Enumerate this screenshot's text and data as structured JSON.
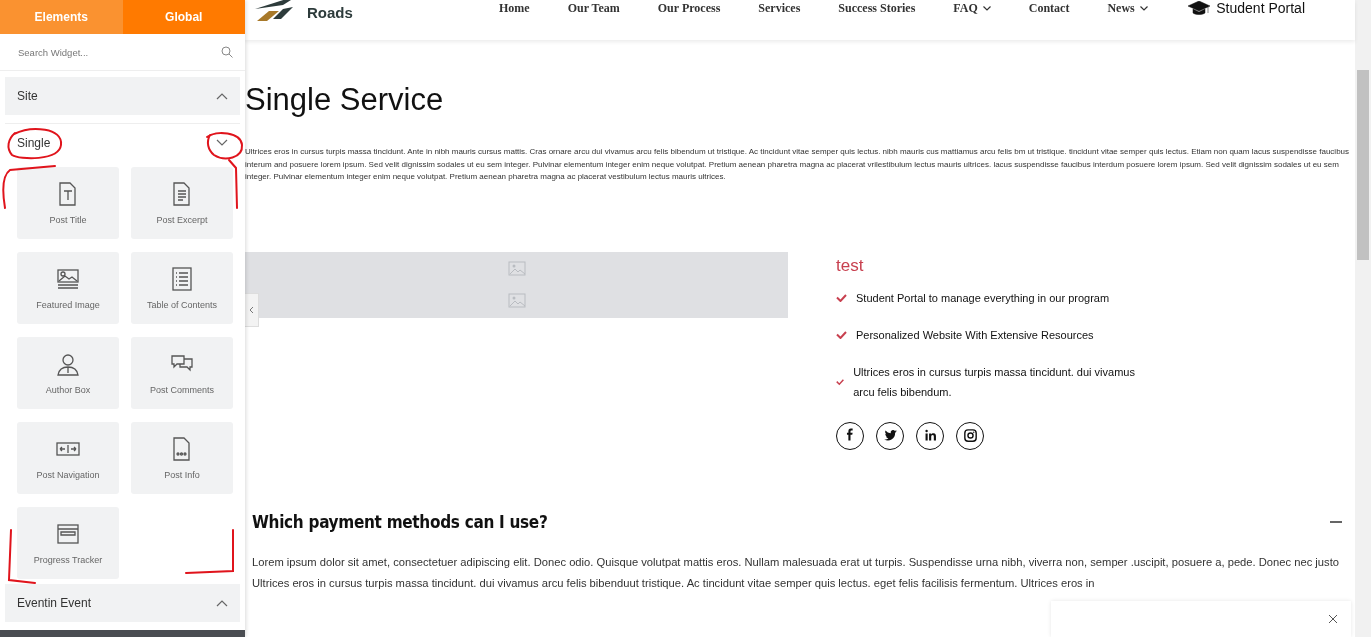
{
  "sidebar": {
    "tabs": [
      {
        "label": "Elements",
        "selected": true
      },
      {
        "label": "Global",
        "selected": false
      }
    ],
    "search": {
      "placeholder": "Search Widget..."
    },
    "categories": [
      {
        "label": "Site",
        "expanded": false
      },
      {
        "label": "Single",
        "expanded": true,
        "widgets": [
          {
            "label": "Post Title",
            "kind": "title"
          },
          {
            "label": "Post Excerpt",
            "kind": "excerpt"
          },
          {
            "label": "Featured Image",
            "kind": "image"
          },
          {
            "label": "Table of Contents",
            "kind": "toc"
          },
          {
            "label": "Author Box",
            "kind": "author"
          },
          {
            "label": "Post Comments",
            "kind": "comments"
          },
          {
            "label": "Post Navigation",
            "kind": "navigation"
          },
          {
            "label": "Post Info",
            "kind": "info"
          },
          {
            "label": "Progress Tracker",
            "kind": "tracker"
          }
        ]
      },
      {
        "label": "Eventin Event",
        "expanded": false
      }
    ]
  },
  "header": {
    "logo_text": "Roads",
    "nav": [
      {
        "label": "Home",
        "has_menu": false
      },
      {
        "label": "Our Team",
        "has_menu": false
      },
      {
        "label": "Our Process",
        "has_menu": false
      },
      {
        "label": "Services",
        "has_menu": false
      },
      {
        "label": "Success Stories",
        "has_menu": false
      },
      {
        "label": "FAQ",
        "has_menu": true
      },
      {
        "label": "Contact",
        "has_menu": false
      },
      {
        "label": "News",
        "has_menu": true
      }
    ],
    "portal": "Student Portal"
  },
  "page": {
    "title": "Single Service",
    "intro": "Ultrices eros in cursus turpis massa tincidunt. Ante in nibh mauris cursus mattis. Cras ornare arcu dui vivamus arcu felis bibendum ut tristique. Ac tincidunt vitae semper quis lectus. nibh mauris cus mattiamus arcu felis bm ut tristique. tincidunt vitae semper quis lectus. Etiam non quam lacus suspendisse faucibus interum and posuere lorem ipsum. Sed velit dignissim sodales ut eu sem integer. Pulvinar elementum integer enim neque volutpat. Pretium aenean pharetra magna ac placerat vrilestibulum lectus mauris ultrices. lacus suspendisse faucibus interdum posuere lorem ipsum. Sed velit dignissim sodales ut eu sem integer. Pulvinar elementum integer enim neque volutpat. Pretium aenean pharetra magna ac placerat vestibulum lectus mauris ultrices.",
    "feature_title": "test",
    "features": [
      "Student Portal to manage everything in our program",
      "Personalized Website With Extensive Resources",
      "Ultrices eros in cursus turpis massa tincidunt. dui vivamus arcu felis bibendum."
    ],
    "socials": [
      {
        "kind": "facebook"
      },
      {
        "kind": "twitter"
      },
      {
        "kind": "linkedin"
      },
      {
        "kind": "instagram"
      }
    ],
    "faq": {
      "question": "Which payment methods can I use?",
      "expanded": true,
      "answer": "Lorem ipsum dolor sit amet, consectetuer adipiscing elit. Donec odio. Quisque volutpat mattis eros. Nullam malesuada erat ut turpis. Suspendisse urna nibh, viverra non, semper .uscipit, posuere a, pede. Donec nec justo Ultrices eros in cursus turpis massa tincidunt. dui vivamus arcu felis bibenduut tristique. Ac tincidunt vitae semper quis lectus. eget felis facilisis fermentum. Ultrices eros in"
    }
  }
}
